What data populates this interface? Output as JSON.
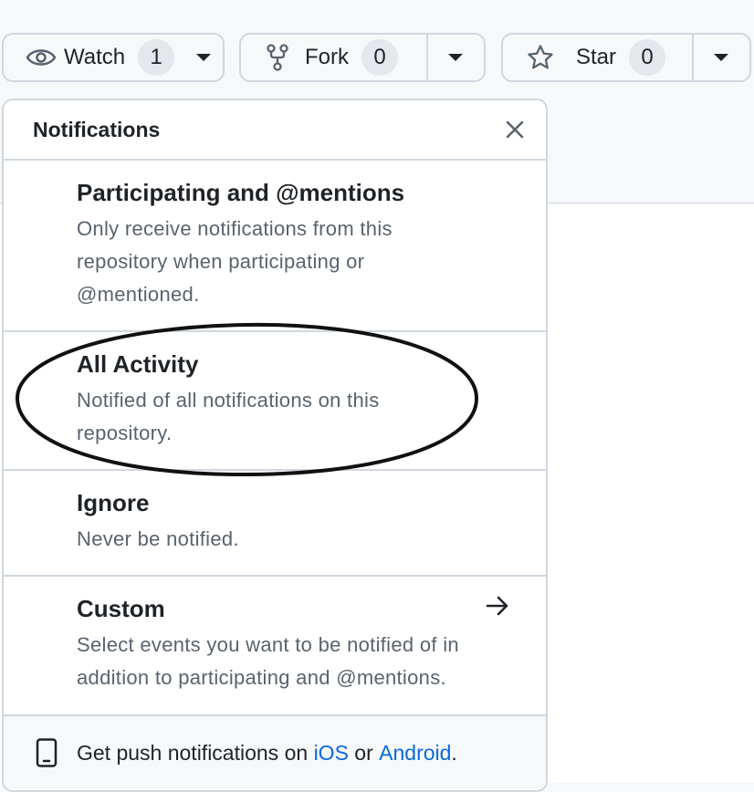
{
  "toolbar": {
    "watch": {
      "label": "Watch",
      "count": "1"
    },
    "fork": {
      "label": "Fork",
      "count": "0"
    },
    "star": {
      "label": "Star",
      "count": "0"
    }
  },
  "panel": {
    "title": "Notifications",
    "items": [
      {
        "title": "Participating and @mentions",
        "desc_lines": [
          "Only receive notifications from this",
          "repository when participating or",
          "@mentioned."
        ]
      },
      {
        "title": "All Activity",
        "desc_lines": [
          "Notified of all notifications on this",
          "repository."
        ]
      },
      {
        "title": "Ignore",
        "desc_lines": [
          "Never be notified."
        ]
      },
      {
        "title": "Custom",
        "desc_lines": [
          "Select events you want to be notified of in",
          "addition to participating and @mentions."
        ]
      }
    ],
    "footer": {
      "prefix": "Get push notifications on ",
      "ios": "iOS",
      "middle": " or ",
      "android": "Android",
      "suffix": "."
    }
  },
  "colors": {
    "accent_link": "#0969da",
    "border": "#d0d7de",
    "annotation": "#111111"
  },
  "icons": [
    "eye-icon",
    "caret-down-icon",
    "repo-forked-icon",
    "star-icon",
    "close-icon",
    "arrow-right-icon",
    "device-mobile-icon"
  ]
}
